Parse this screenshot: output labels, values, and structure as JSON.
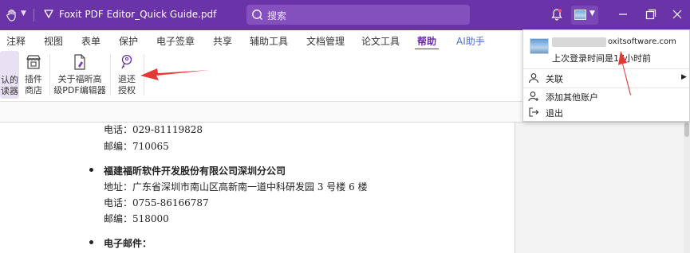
{
  "titlebar": {
    "title": "Foxit PDF Editor_Quick Guide.pdf",
    "search_placeholder": "搜索",
    "accent": "#6a33a8"
  },
  "menu": {
    "tabs": [
      "注释",
      "视图",
      "表单",
      "保护",
      "电子签章",
      "共享",
      "辅助工具",
      "文档管理",
      "论文工具",
      "帮助",
      "AI助手"
    ],
    "active": "帮助",
    "active_color": "#6a2ca8",
    "ai_color": "#4a6fd8"
  },
  "ribbon": {
    "default_reader_line1": "认的",
    "default_reader_line2": "读器",
    "plugin_store_line1": "插件",
    "plugin_store_line2": "商店",
    "about_line1": "关于福昕高",
    "about_line2": "级PDF编辑器",
    "return_license_line1": "退还",
    "return_license_line2": "授权"
  },
  "document": {
    "phone1": "电话：029-81119828",
    "postcode1": "邮编：710065",
    "company": "福建福昕软件开发股份有限公司深圳分公司",
    "address": "地址：广东省深圳市南山区高新南一道中科研发园 3 号楼 6 楼",
    "phone2": "电话：0755-86166787",
    "postcode2": "邮编：518000",
    "email_heading": "电子邮件："
  },
  "account_menu": {
    "email_suffix": "oxitsoftware.com",
    "last_login": "上次登录时间是17小时前",
    "items": [
      "关联",
      "添加其他账户",
      "退出"
    ]
  },
  "annotation_color": "#e53935"
}
